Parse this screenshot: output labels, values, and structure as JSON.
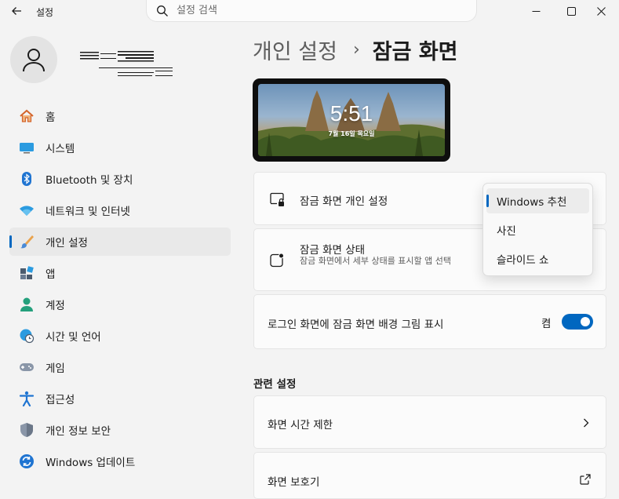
{
  "window": {
    "title": "설정"
  },
  "search": {
    "placeholder": "설정 검색"
  },
  "sidebar": {
    "items": [
      {
        "label": "홈"
      },
      {
        "label": "시스템"
      },
      {
        "label": "Bluetooth 및 장치"
      },
      {
        "label": "네트워크 및 인터넷"
      },
      {
        "label": "개인 설정"
      },
      {
        "label": "앱"
      },
      {
        "label": "계정"
      },
      {
        "label": "시간 및 언어"
      },
      {
        "label": "게임"
      },
      {
        "label": "접근성"
      },
      {
        "label": "개인 정보 보안"
      },
      {
        "label": "Windows 업데이트"
      }
    ],
    "active_index": 4
  },
  "header": {
    "parent": "개인 설정",
    "separator": "›",
    "current": "잠금 화면"
  },
  "preview": {
    "time": "5:51",
    "date": "7월 16일 목요일"
  },
  "settings": {
    "personalize": {
      "title": "잠금 화면 개인 설정"
    },
    "status": {
      "title": "잠금 화면 상태",
      "description": "잠금 화면에서 세부 상태를 표시할 앱 선택"
    },
    "signin_background": {
      "title": "로그인 화면에 잠금 화면 배경 그림 표시",
      "state": "켬",
      "enabled": true
    }
  },
  "dropdown": {
    "options": [
      "Windows 추천",
      "사진",
      "슬라이드 쇼"
    ],
    "selected_index": 0
  },
  "related": {
    "heading": "관련 설정",
    "items": [
      {
        "label": "화면 시간 제한"
      },
      {
        "label": "화면 보호기"
      }
    ]
  },
  "colors": {
    "accent": "#0067c0",
    "background": "#f3f3f3",
    "card": "#fbfbfb"
  }
}
